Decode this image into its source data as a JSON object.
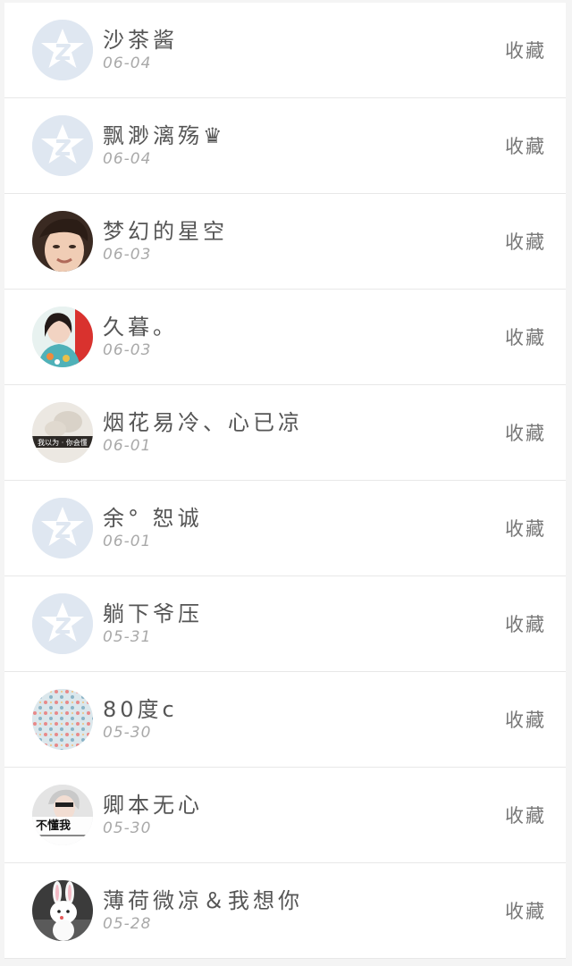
{
  "favorite_label": "收藏",
  "colors": {
    "row_bg": "#ffffff",
    "separator": "#e8e8e8",
    "name_text": "#555555",
    "date_text": "#a9a9a9",
    "default_avatar_bg": "#dfe7f1",
    "default_avatar_icon": "#ffffff"
  },
  "items": [
    {
      "name": "沙茶酱",
      "date": "06-04",
      "avatar": "default-qzone-avatar"
    },
    {
      "name": "飘渺漓殇♛",
      "date": "06-04",
      "avatar": "default-qzone-avatar"
    },
    {
      "name": "梦幻的星空",
      "date": "06-03",
      "avatar": "photo-young-man"
    },
    {
      "name": "久暮。",
      "date": "06-03",
      "avatar": "photo-girl-colorful"
    },
    {
      "name": "烟花易冷、心已凉",
      "date": "06-01",
      "avatar": "photo-pale-hands-text"
    },
    {
      "name": "余° 恕诚",
      "date": "06-01",
      "avatar": "default-qzone-avatar"
    },
    {
      "name": "躺下爷压",
      "date": "05-31",
      "avatar": "default-qzone-avatar"
    },
    {
      "name": "80度c",
      "date": "05-30",
      "avatar": "pattern-floral-dots"
    },
    {
      "name": "卿本无心",
      "date": "05-30",
      "avatar": "photo-boy-text"
    },
    {
      "name": "薄荷微凉＆我想你",
      "date": "05-28",
      "avatar": "photo-bunny-doll"
    }
  ],
  "avatar_text": {
    "photo-pale-hands-text": "我以为 · 你会懂",
    "photo-boy-text": "不懂我"
  }
}
